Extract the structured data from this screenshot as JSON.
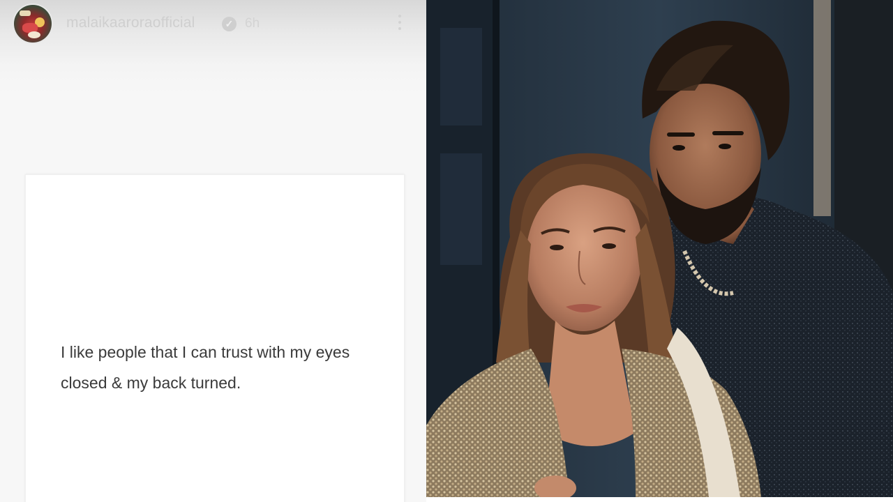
{
  "story": {
    "username": "malaikaaroraofficial",
    "time": "6h",
    "quote": "I like people that I can trust with my eyes closed & my back turned."
  },
  "photo": {
    "subject": "couple portrait"
  },
  "colors": {
    "story_bg": "#f7f7f7",
    "header_text": "#cfcfcf",
    "quote_text": "#3a3a3a",
    "photo_bg": "#243240"
  },
  "icons": {
    "verified": "verified-badge-icon",
    "more": "more-options-icon"
  }
}
